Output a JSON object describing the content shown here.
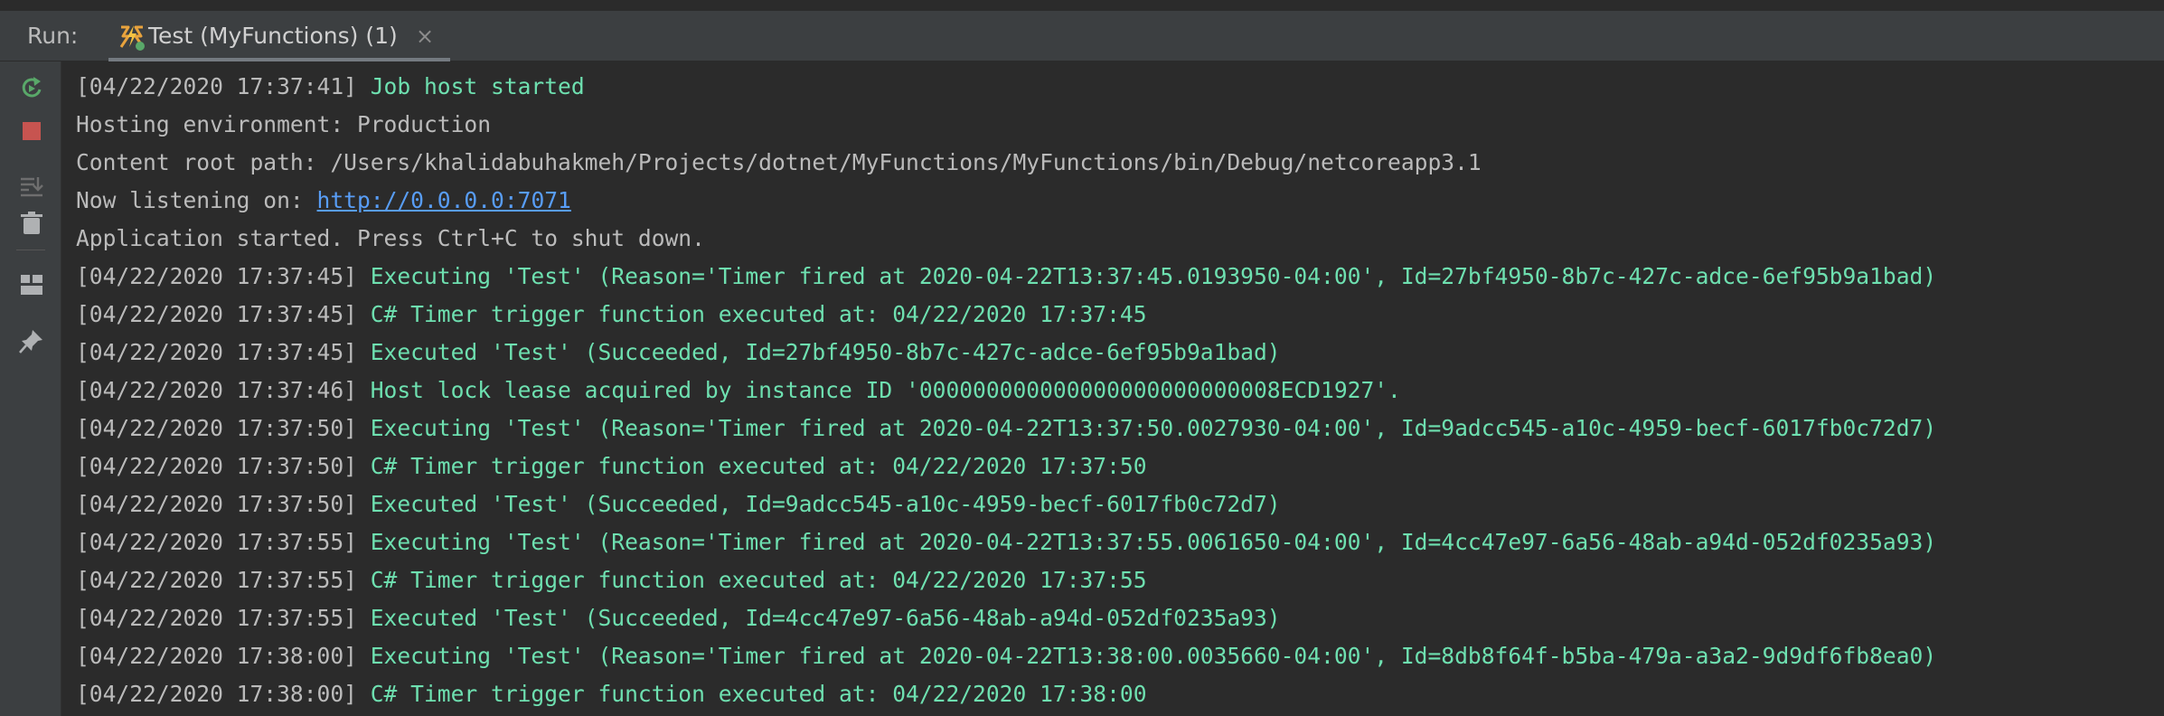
{
  "run_panel": {
    "label": "Run:",
    "tab": {
      "title": "Test (MyFunctions) (1)",
      "close": "×",
      "icon": "azure-function-icon"
    }
  },
  "toolbar": {
    "rerun": "rerun-icon",
    "stop": "stop-icon",
    "scroll_to_end": "scroll-to-end-icon",
    "clear": "trash-icon",
    "layout": "layout-icon",
    "pin": "pin-icon"
  },
  "colors": {
    "timestamp": "#bbbbbb",
    "log_message": "#6ee0b0",
    "link": "#589df6",
    "stop": "#c75450",
    "rerun": "#59a869"
  },
  "console": {
    "lines": [
      {
        "ts": "[04/22/2020 17:37:41] ",
        "msg": "Job host started"
      },
      {
        "plain": "Hosting environment: Production"
      },
      {
        "plain": "Content root path: /Users/khalidabuhakmeh/Projects/dotnet/MyFunctions/MyFunctions/bin/Debug/netcoreapp3.1"
      },
      {
        "prefix": "Now listening on: ",
        "link": "http://0.0.0.0:7071"
      },
      {
        "plain": "Application started. Press Ctrl+C to shut down."
      },
      {
        "ts": "[04/22/2020 17:37:45] ",
        "msg": "Executing 'Test' (Reason='Timer fired at 2020-04-22T13:37:45.0193950-04:00', Id=27bf4950-8b7c-427c-adce-6ef95b9a1bad)"
      },
      {
        "ts": "[04/22/2020 17:37:45] ",
        "msg": "C# Timer trigger function executed at: 04/22/2020 17:37:45"
      },
      {
        "ts": "[04/22/2020 17:37:45] ",
        "msg": "Executed 'Test' (Succeeded, Id=27bf4950-8b7c-427c-adce-6ef95b9a1bad)"
      },
      {
        "ts": "[04/22/2020 17:37:46] ",
        "msg": "Host lock lease acquired by instance ID '000000000000000000000000008ECD1927'."
      },
      {
        "ts": "[04/22/2020 17:37:50] ",
        "msg": "Executing 'Test' (Reason='Timer fired at 2020-04-22T13:37:50.0027930-04:00', Id=9adcc545-a10c-4959-becf-6017fb0c72d7)"
      },
      {
        "ts": "[04/22/2020 17:37:50] ",
        "msg": "C# Timer trigger function executed at: 04/22/2020 17:37:50"
      },
      {
        "ts": "[04/22/2020 17:37:50] ",
        "msg": "Executed 'Test' (Succeeded, Id=9adcc545-a10c-4959-becf-6017fb0c72d7)"
      },
      {
        "ts": "[04/22/2020 17:37:55] ",
        "msg": "Executing 'Test' (Reason='Timer fired at 2020-04-22T13:37:55.0061650-04:00', Id=4cc47e97-6a56-48ab-a94d-052df0235a93)"
      },
      {
        "ts": "[04/22/2020 17:37:55] ",
        "msg": "C# Timer trigger function executed at: 04/22/2020 17:37:55"
      },
      {
        "ts": "[04/22/2020 17:37:55] ",
        "msg": "Executed 'Test' (Succeeded, Id=4cc47e97-6a56-48ab-a94d-052df0235a93)"
      },
      {
        "ts": "[04/22/2020 17:38:00] ",
        "msg": "Executing 'Test' (Reason='Timer fired at 2020-04-22T13:38:00.0035660-04:00', Id=8db8f64f-b5ba-479a-a3a2-9d9df6fb8ea0)"
      },
      {
        "ts": "[04/22/2020 17:38:00] ",
        "msg": "C# Timer trigger function executed at: 04/22/2020 17:38:00"
      }
    ]
  }
}
